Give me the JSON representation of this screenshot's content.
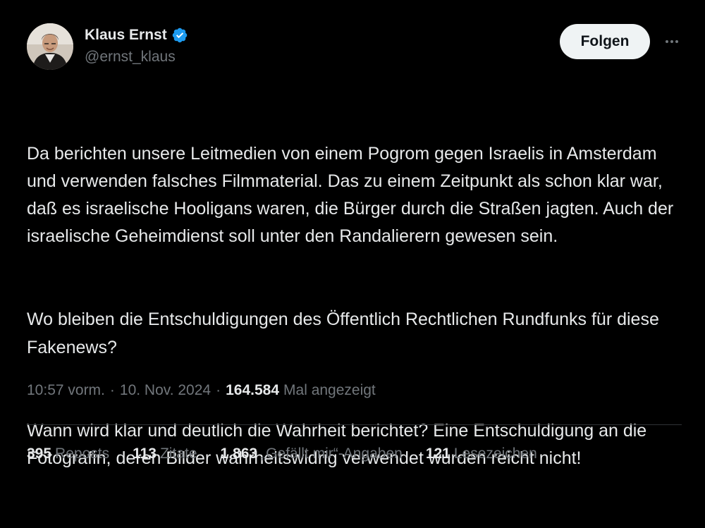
{
  "author": {
    "display_name": "Klaus Ernst",
    "handle": "@ernst_klaus",
    "verified": true,
    "verified_icon": "verified-badge-icon",
    "avatar_icon": "avatar-photo"
  },
  "actions": {
    "follow_label": "Folgen",
    "more_icon": "more-icon"
  },
  "tweet": {
    "paragraphs": [
      "Da berichten unsere Leitmedien von einem Pogrom gegen Israelis in Amsterdam und verwenden falsches Filmmaterial. Das zu einem Zeitpunkt als schon klar war, daß es israelische Hooligans waren, die Bürger durch die Straßen jagten. Auch der israelische Geheimdienst soll unter den Randalierern gewesen sein.",
      "Wo bleiben die Entschuldigungen des Öffentlich Rechtlichen Rundfunks für diese Fakenews?",
      "Wann wird klar und deutlich die Wahrheit berichtet? Eine Entschuldigung an die Fotografin, deren Bilder wahrheitswidrig verwendet wurden reicht nicht!"
    ]
  },
  "meta": {
    "time": "10:57 vorm.",
    "separator": "·",
    "date": "10. Nov. 2024",
    "views_count": "164.584",
    "views_label": "Mal angezeigt"
  },
  "stats": [
    {
      "count": "395",
      "label": "Reposts"
    },
    {
      "count": "113",
      "label": "Zitate"
    },
    {
      "count": "1.863",
      "label": "„Gefällt mir“-Angaben"
    },
    {
      "count": "121",
      "label": "Lesezeichen"
    }
  ],
  "colors": {
    "background": "#000000",
    "text_primary": "#e7e9ea",
    "text_secondary": "#71767b",
    "verified_blue": "#1d9bf0",
    "follow_button_bg": "#eff3f4",
    "divider": "#2f3336"
  }
}
